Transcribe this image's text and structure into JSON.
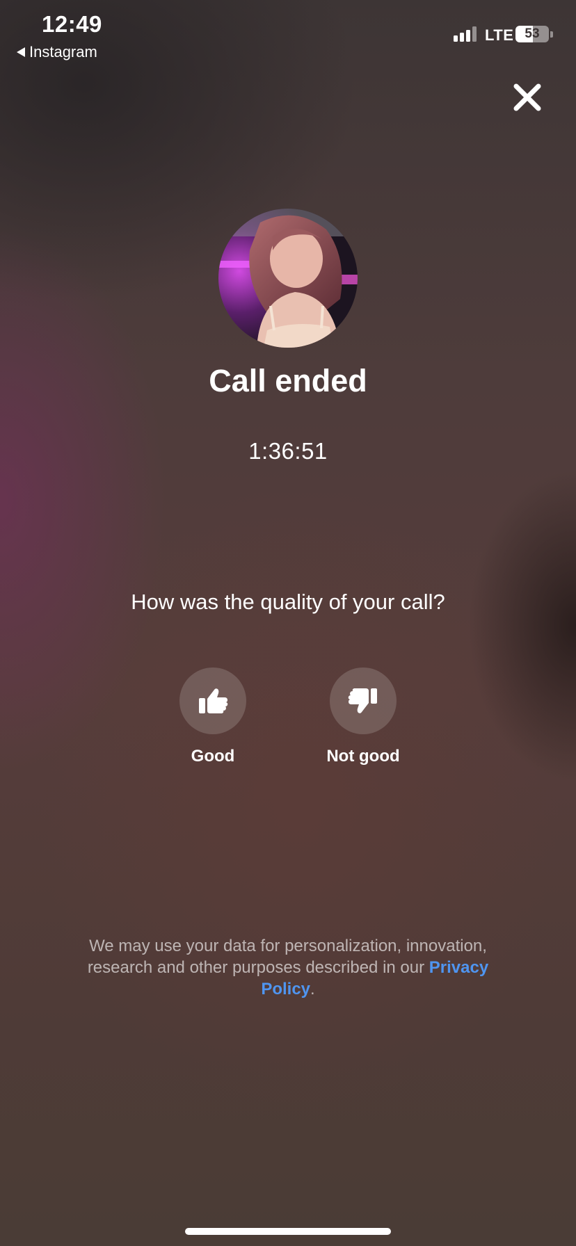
{
  "status_bar": {
    "time": "12:49",
    "back_app": "Instagram",
    "network": "LTE",
    "battery": "53",
    "battery_level": 0.53,
    "signal_bars": 3
  },
  "icons": {
    "close": "close-icon",
    "good": "thumbs-up-icon",
    "not_good": "thumbs-down-icon"
  },
  "call": {
    "title": "Call ended",
    "duration": "1:36:51"
  },
  "feedback": {
    "question": "How was the quality of your call?",
    "good_label": "Good",
    "not_good_label": "Not good"
  },
  "disclaimer": {
    "text": "We may use your data for personalization, innovation, research and other purposes described in our ",
    "link": "Privacy Policy",
    "end": "."
  },
  "colors": {
    "link": "#4f95f0",
    "background": "#563d3b"
  }
}
